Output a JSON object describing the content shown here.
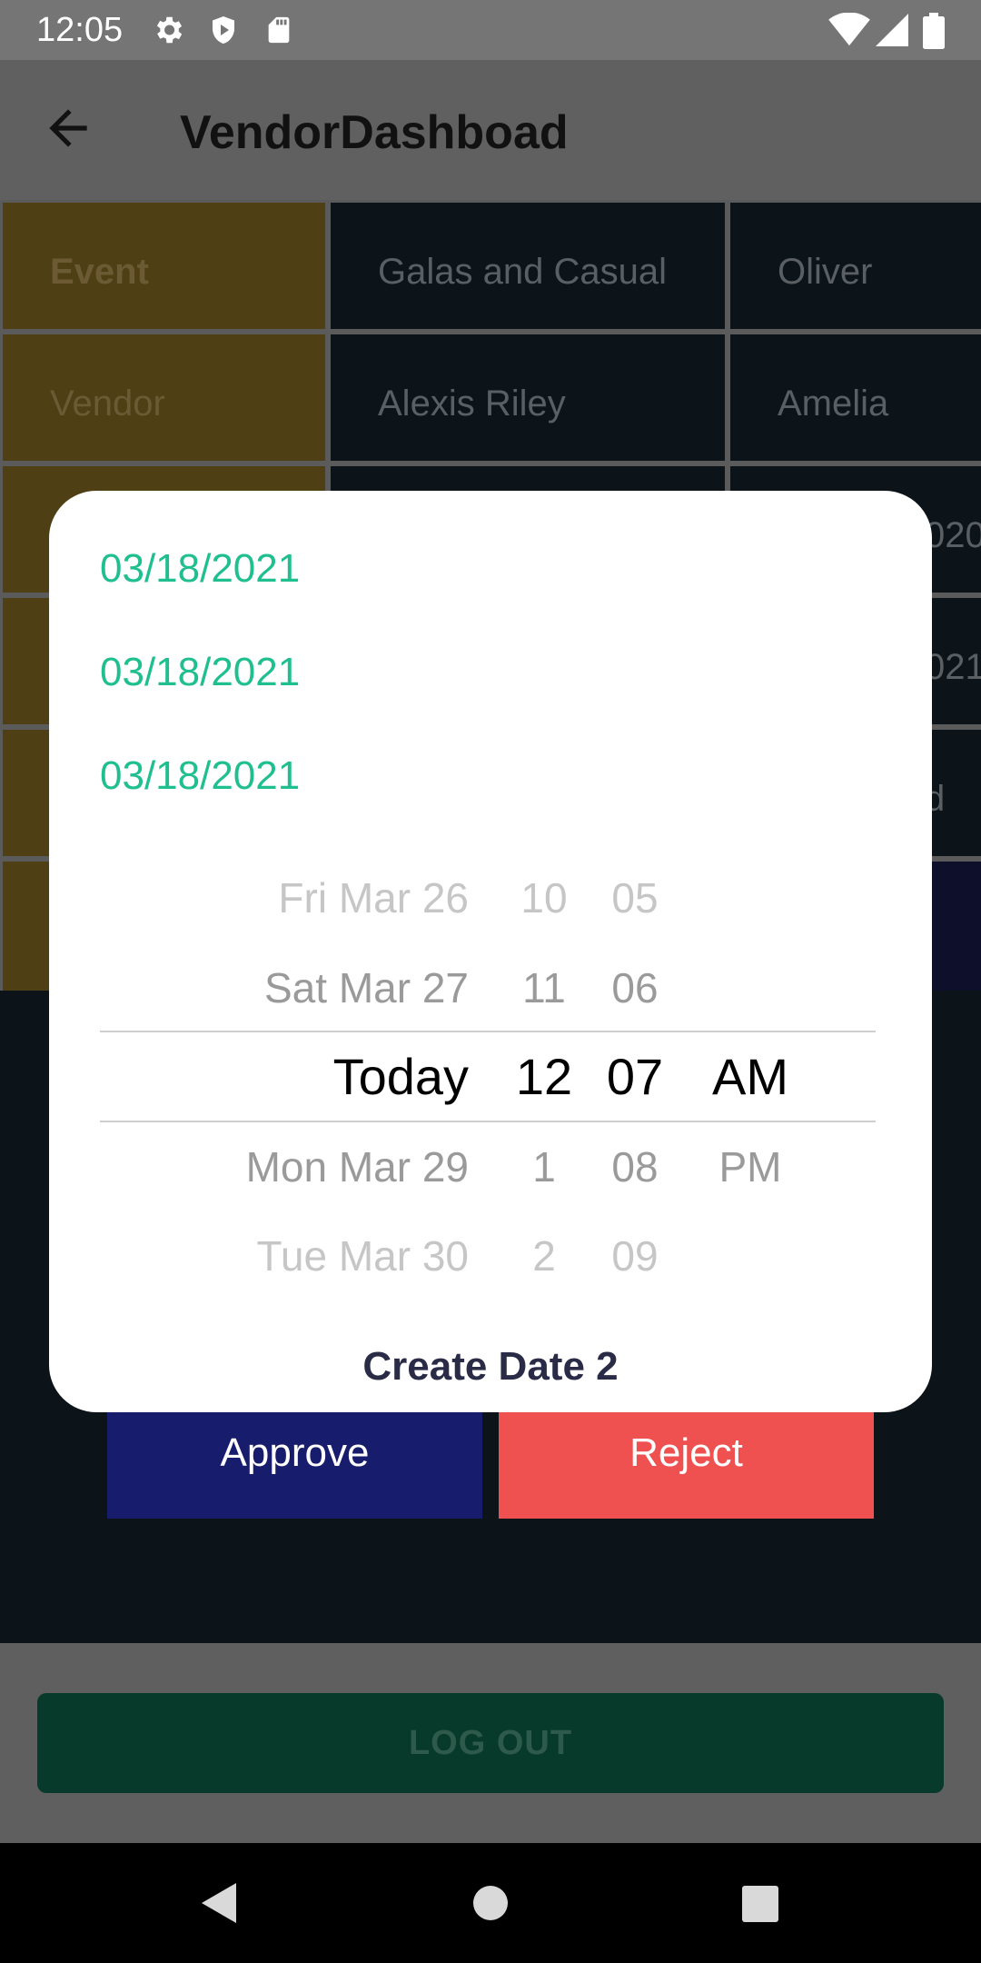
{
  "status_bar": {
    "time": "12:05",
    "icons": [
      "gear-icon",
      "shield-icon",
      "sd-card-icon",
      "wifi-icon",
      "signal-icon",
      "battery-icon"
    ]
  },
  "app_bar": {
    "title": "VendorDashboad",
    "back_icon": "arrow-left-icon"
  },
  "table": {
    "row_labels": [
      "Event",
      "Vendor"
    ],
    "rows": [
      [
        "Galas and Casual",
        "Oliver"
      ],
      [
        "Alexis Riley",
        "Amelia"
      ]
    ],
    "partial_cells": [
      "020",
      "021",
      "d"
    ]
  },
  "dialog": {
    "dates": [
      "03/18/2021",
      "03/18/2021",
      "03/18/2021"
    ],
    "picker": {
      "rows": [
        {
          "day": "Fri Mar 26",
          "hour": "10",
          "minute": "05",
          "ampm": ""
        },
        {
          "day": "Sat Mar 27",
          "hour": "11",
          "minute": "06",
          "ampm": ""
        },
        {
          "day": "Today",
          "hour": "12",
          "minute": "07",
          "ampm": "AM"
        },
        {
          "day": "Mon Mar 29",
          "hour": "1",
          "minute": "08",
          "ampm": "PM"
        },
        {
          "day": "Tue Mar 30",
          "hour": "2",
          "minute": "09",
          "ampm": ""
        }
      ]
    },
    "caption": "Create Date 2"
  },
  "actions": {
    "approve": "Approve",
    "reject": "Reject"
  },
  "logout": "LOG OUT",
  "nav_bar": {
    "icons": [
      "back-triangle-icon",
      "home-circle-icon",
      "recents-square-icon"
    ]
  },
  "colors": {
    "accent_green": "#1fbf8f",
    "approve": "#181c6c",
    "reject": "#ef5050",
    "caption": "#2a2b46"
  }
}
